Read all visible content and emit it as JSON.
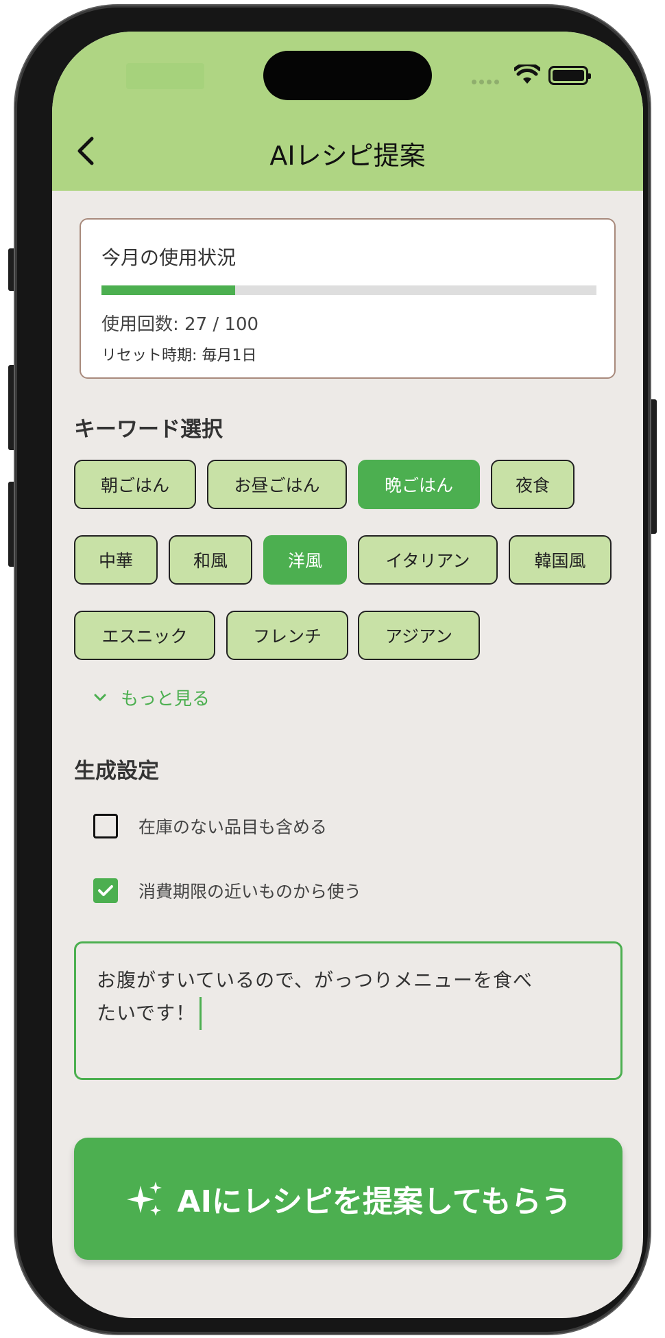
{
  "app": {
    "nav_title": "AIレシピ提案"
  },
  "usage": {
    "title": "今月の使用状況",
    "count_text": "使用回数: 27 / 100",
    "used": 27,
    "limit": 100,
    "progress_fraction": 0.27,
    "reset_text": "リセット時期: 毎月1日"
  },
  "keywords": {
    "title": "キーワード選択",
    "chips": [
      {
        "label": "朝ごはん",
        "selected": false
      },
      {
        "label": "お昼ごはん",
        "selected": false
      },
      {
        "label": "晩ごはん",
        "selected": true
      },
      {
        "label": "夜食",
        "selected": false
      },
      {
        "label": "中華",
        "selected": false
      },
      {
        "label": "和風",
        "selected": false
      },
      {
        "label": "洋風",
        "selected": true
      },
      {
        "label": "イタリアン",
        "selected": false
      },
      {
        "label": "韓国風",
        "selected": false
      },
      {
        "label": "エスニック",
        "selected": false
      },
      {
        "label": "フレンチ",
        "selected": false
      },
      {
        "label": "アジアン",
        "selected": false
      }
    ],
    "more_label": "もっと見る"
  },
  "settings": {
    "title": "生成設定",
    "options": [
      {
        "label": "在庫のない品目も含める",
        "checked": false
      },
      {
        "label": "消費期限の近いものから使う",
        "checked": true
      }
    ]
  },
  "request": {
    "value_line1": "お腹がすいているので、がっつりメニューを食べ",
    "value_line2": "たいです！"
  },
  "submit": {
    "label": "AIにレシピを提案してもらう"
  },
  "colors": {
    "accent": "#4caf50",
    "header": "#afd583",
    "chip": "#c8e1a6",
    "background": "#edeae7"
  }
}
